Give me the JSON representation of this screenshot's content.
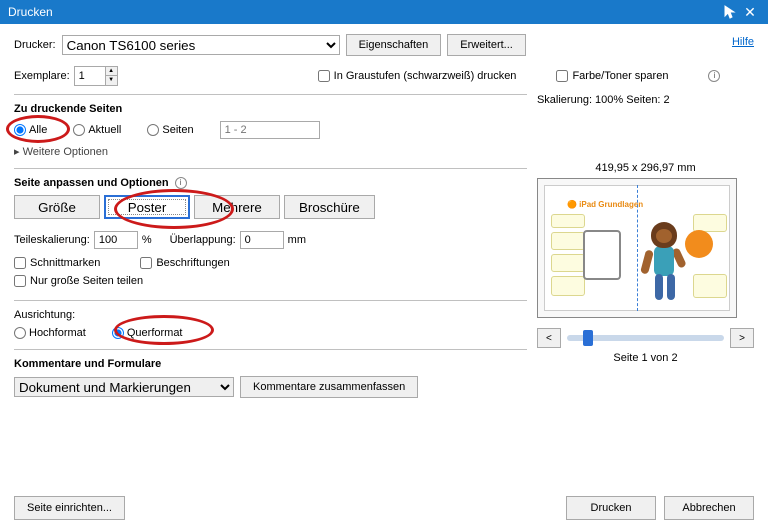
{
  "window": {
    "title": "Drucken"
  },
  "help": {
    "label": "Hilfe"
  },
  "printer": {
    "label": "Drucker:",
    "value": "Canon TS6100 series",
    "properties_btn": "Eigenschaften",
    "advanced_btn": "Erweitert..."
  },
  "copies": {
    "label": "Exemplare:",
    "value": "1"
  },
  "options_row": {
    "grayscale": "In Graustufen (schwarzweiß) drucken",
    "savetoner": "Farbe/Toner sparen"
  },
  "pages": {
    "heading": "Zu druckende Seiten",
    "all": "Alle",
    "current": "Aktuell",
    "range_label": "Seiten",
    "range_placeholder": "1 - 2",
    "more": "Weitere Optionen"
  },
  "sizing": {
    "heading": "Seite anpassen und Optionen",
    "size": "Größe",
    "poster": "Poster",
    "multiple": "Mehrere",
    "booklet": "Broschüre",
    "tilescale_label": "Teileskalierung:",
    "tilescale_value": "100",
    "tilescale_unit": "%",
    "overlap_label": "Überlappung:",
    "overlap_value": "0",
    "overlap_unit": "mm",
    "cutmarks": "Schnittmarken",
    "labels": "Beschriftungen",
    "bigonly": "Nur große Seiten teilen"
  },
  "orientation": {
    "heading": "Ausrichtung:",
    "portrait": "Hochformat",
    "landscape": "Querformat"
  },
  "comments": {
    "heading": "Kommentare und Formulare",
    "value": "Dokument und Markierungen",
    "summarize": "Kommentare zusammenfassen"
  },
  "preview": {
    "scaling": "Skalierung: 100% Seiten: 2",
    "dimensions": "419,95 x 296,97 mm",
    "doc_title": "iPad Grundlagen",
    "page_of": "Seite 1 von 2",
    "prev": "<",
    "next": ">"
  },
  "footer": {
    "pagesetup": "Seite einrichten...",
    "print": "Drucken",
    "cancel": "Abbrechen"
  }
}
